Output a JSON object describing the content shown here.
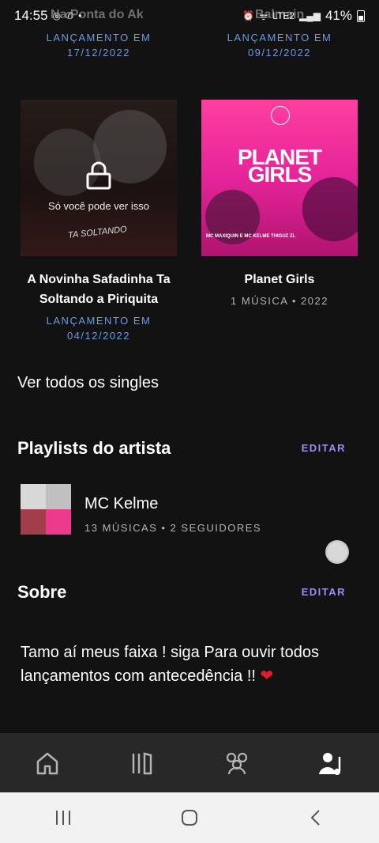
{
  "status_bar": {
    "time": "14:55",
    "battery": "41%",
    "network": "LTE2",
    "notification_icons": [
      "instagram-icon",
      "whatsapp-icon"
    ]
  },
  "overlay_titles": {
    "left": "Na Ponta do Ak",
    "right": "Balmain"
  },
  "top_release": [
    {
      "label": "LANÇAMENTO EM",
      "date": "17/12/2022"
    },
    {
      "label": "LANÇAMENTO EM",
      "date": "09/12/2022"
    }
  ],
  "albums": [
    {
      "title_line1": "A Novinha Safadinha Ta",
      "title_line2": "Soltando a Piriquita",
      "release_label": "LANÇAMENTO EM",
      "release_date": "04/12/2022",
      "locked_text": "Só você pode ver isso",
      "cover_text": "TA SOLTANDO"
    },
    {
      "title": "Planet Girls",
      "meta": "1 MÚSICA • 2022",
      "cover_title_line1": "PLANET",
      "cover_title_line2": "GIRLS",
      "cover_credit": "MC MAXIQUIN E MC KELME THIGUZ ZL"
    }
  ],
  "see_all_singles": "Ver todos os singles",
  "playlists_section": {
    "title": "Playlists do artista",
    "edit": "EDITAR",
    "items": [
      {
        "name": "MC Kelme",
        "meta": "13 MÚSICAS • 2 SEGUIDORES"
      }
    ]
  },
  "about_section": {
    "title": "Sobre",
    "edit": "EDITAR",
    "text": "Tamo aí meus faixa ! siga Para ouvir todos lançamentos com antecedência !!"
  },
  "bottom_nav": [
    {
      "icon": "home-icon"
    },
    {
      "icon": "library-icon"
    },
    {
      "icon": "audience-icon"
    },
    {
      "icon": "profile-music-icon"
    }
  ],
  "colors": {
    "background": "#121212",
    "accent": "#9d8cf2",
    "release": "#6b9be6",
    "nav": "#282828"
  }
}
